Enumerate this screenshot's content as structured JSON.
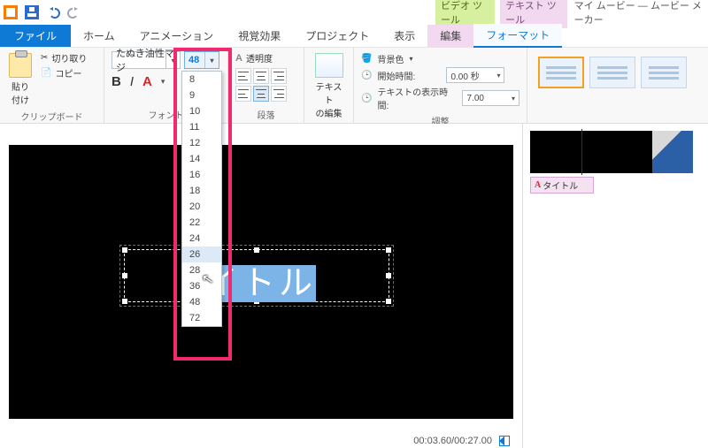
{
  "app": {
    "title": "マイ ムービー — ムービー メーカー"
  },
  "contextual_tabs": {
    "video": "ビデオ ツール",
    "text": "テキスト ツール"
  },
  "tabs": {
    "file": "ファイル",
    "home": "ホーム",
    "animation": "アニメーション",
    "visual": "視覚効果",
    "project": "プロジェクト",
    "view": "表示",
    "edit": "編集",
    "format": "フォーマット"
  },
  "ribbon": {
    "clipboard": {
      "label": "クリップボード",
      "paste": "貼り\n付け",
      "cut": "切り取り",
      "copy": "コピー"
    },
    "font": {
      "label": "フォント",
      "family": "たぬき油性マジ",
      "size": "48",
      "size_options": [
        "8",
        "9",
        "10",
        "11",
        "12",
        "14",
        "16",
        "18",
        "20",
        "22",
        "24",
        "26",
        "28",
        "36",
        "48",
        "72"
      ]
    },
    "paragraph": {
      "label": "段落",
      "transparency": "透明度"
    },
    "edit_text": {
      "label": "テキスト\nの編集"
    },
    "adjust": {
      "label": "調整",
      "bgcolor": "背景色",
      "start": "開始時間:",
      "show": "テキストの表示時間:",
      "start_val": "0.00 秒",
      "show_val": "7.00"
    }
  },
  "preview": {
    "title_text": "イトル",
    "timecode": "00:03.60/00:27.00"
  },
  "storyboard": {
    "caption": "タイトル",
    "caption_marker": "A"
  }
}
